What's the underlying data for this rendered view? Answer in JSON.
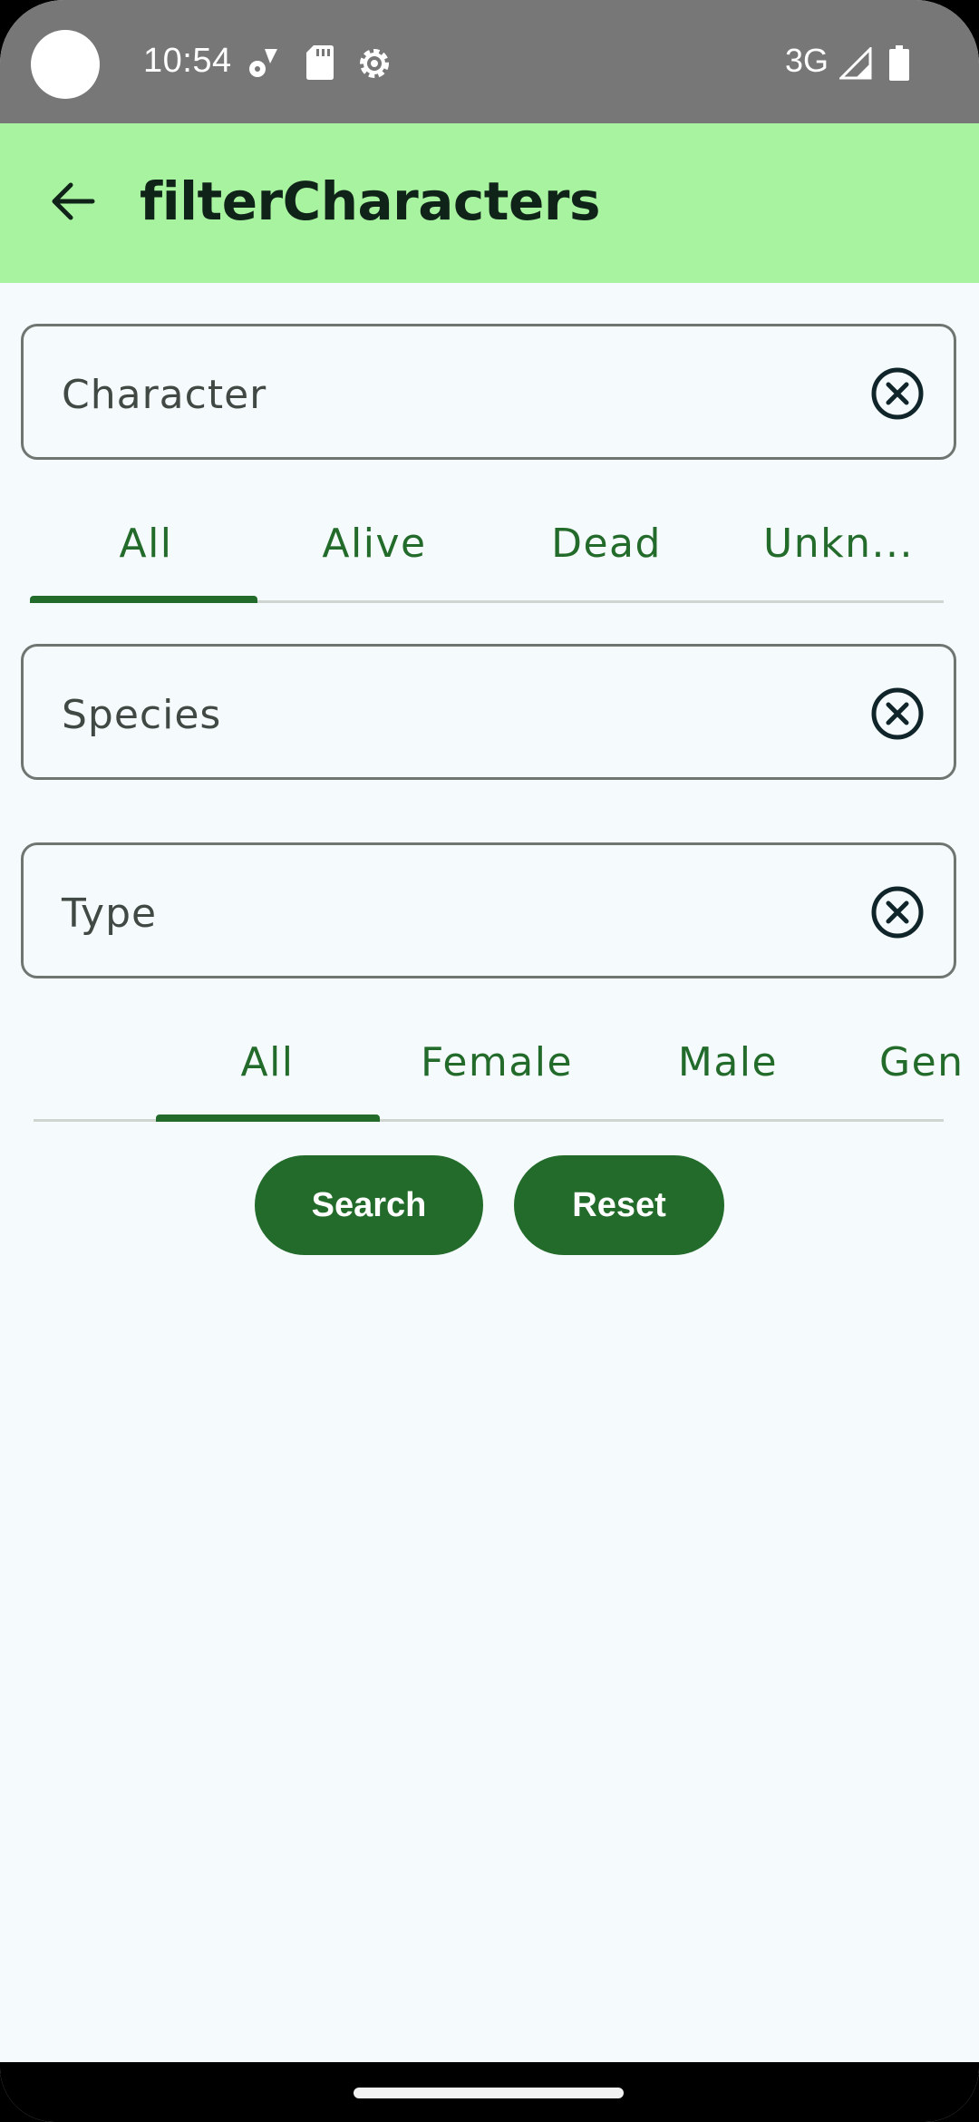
{
  "status_bar": {
    "time": "10:54",
    "network": "3G",
    "icons": [
      "fan-icon",
      "sd-card-icon",
      "settings-gear-icon",
      "signal-icon",
      "battery-icon"
    ]
  },
  "app_bar": {
    "title": "filterCharacters",
    "back_icon": "arrow-back-icon",
    "color": "#a8f3a0"
  },
  "fields": {
    "character": {
      "placeholder": "Character",
      "clear_icon": "clear-circle-icon"
    },
    "species": {
      "placeholder": "Species",
      "clear_icon": "clear-circle-icon"
    },
    "type": {
      "placeholder": "Type",
      "clear_icon": "clear-circle-icon"
    }
  },
  "status_tabs": {
    "items": [
      "All",
      "Alive",
      "Dead",
      "Unkn..."
    ],
    "selected": "All"
  },
  "gender_tabs": {
    "items": [
      "All",
      "Female",
      "Male",
      "Gen"
    ],
    "selected": "All"
  },
  "buttons": {
    "search": "Search",
    "reset": "Reset"
  },
  "colors": {
    "accent": "#226b2a",
    "status_bar": "#777777",
    "background": "#f5fafc"
  }
}
